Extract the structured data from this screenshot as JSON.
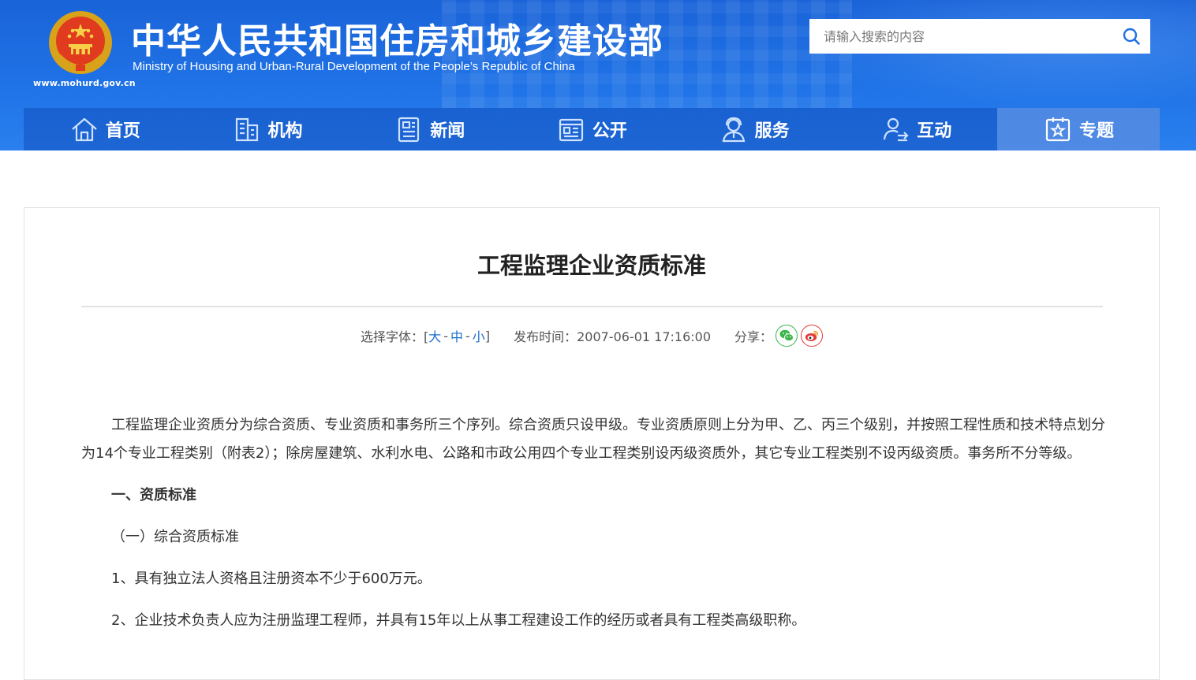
{
  "header": {
    "title_cn": "中华人民共和国住房和城乡建设部",
    "title_en": "Ministry of Housing and Urban-Rural Development of the People’s Republic of China",
    "site_url": "www.mohurd.gov.cn",
    "logo_icon": "national-emblem-icon",
    "search": {
      "placeholder": "请输入搜索的内容",
      "value": "",
      "icon": "search-icon"
    }
  },
  "nav": {
    "items": [
      {
        "label": "首页",
        "icon": "home-icon"
      },
      {
        "label": "机构",
        "icon": "building-icon"
      },
      {
        "label": "新闻",
        "icon": "news-icon"
      },
      {
        "label": "公开",
        "icon": "document-icon"
      },
      {
        "label": "服务",
        "icon": "service-user-icon"
      },
      {
        "label": "互动",
        "icon": "interact-user-icon"
      },
      {
        "label": "专题",
        "icon": "star-board-icon"
      }
    ],
    "active_index": 6
  },
  "article": {
    "title": "工程监理企业资质标准",
    "meta": {
      "font_size_label": "选择字体：[",
      "font_large": "大",
      "font_medium": "中",
      "font_small": "小",
      "font_close": "]",
      "publish_label": "发布时间：",
      "publish_time": "2007-06-01 17:16:00",
      "share_label": "分享：",
      "share_icons": [
        "wechat-icon",
        "weibo-icon"
      ]
    },
    "intro": "工程监理企业资质分为综合资质、专业资质和事务所三个序列。综合资质只设甲级。专业资质原则上分为甲、乙、丙三个级别，并按照工程性质和技术特点划分为14个专业工程类别（附表2）；除房屋建筑、水利水电、公路和市政公用四个专业工程类别设丙级资质外，其它专业工程类别不设丙级资质。事务所不分等级。",
    "section_heading": "一、资质标准",
    "subsection": "（一）综合资质标准",
    "items": [
      "1、具有独立法人资格且注册资本不少于600万元。",
      "2、企业技术负责人应为注册监理工程师，并具有15年以上从事工程建设工作的经历或者具有工程类高级职称。"
    ]
  },
  "colors": {
    "brand_blue": "#1f6fe3",
    "link_blue": "#1a6fd0",
    "wechat_green": "#3bb54a",
    "weibo_red": "#e23a3a"
  }
}
